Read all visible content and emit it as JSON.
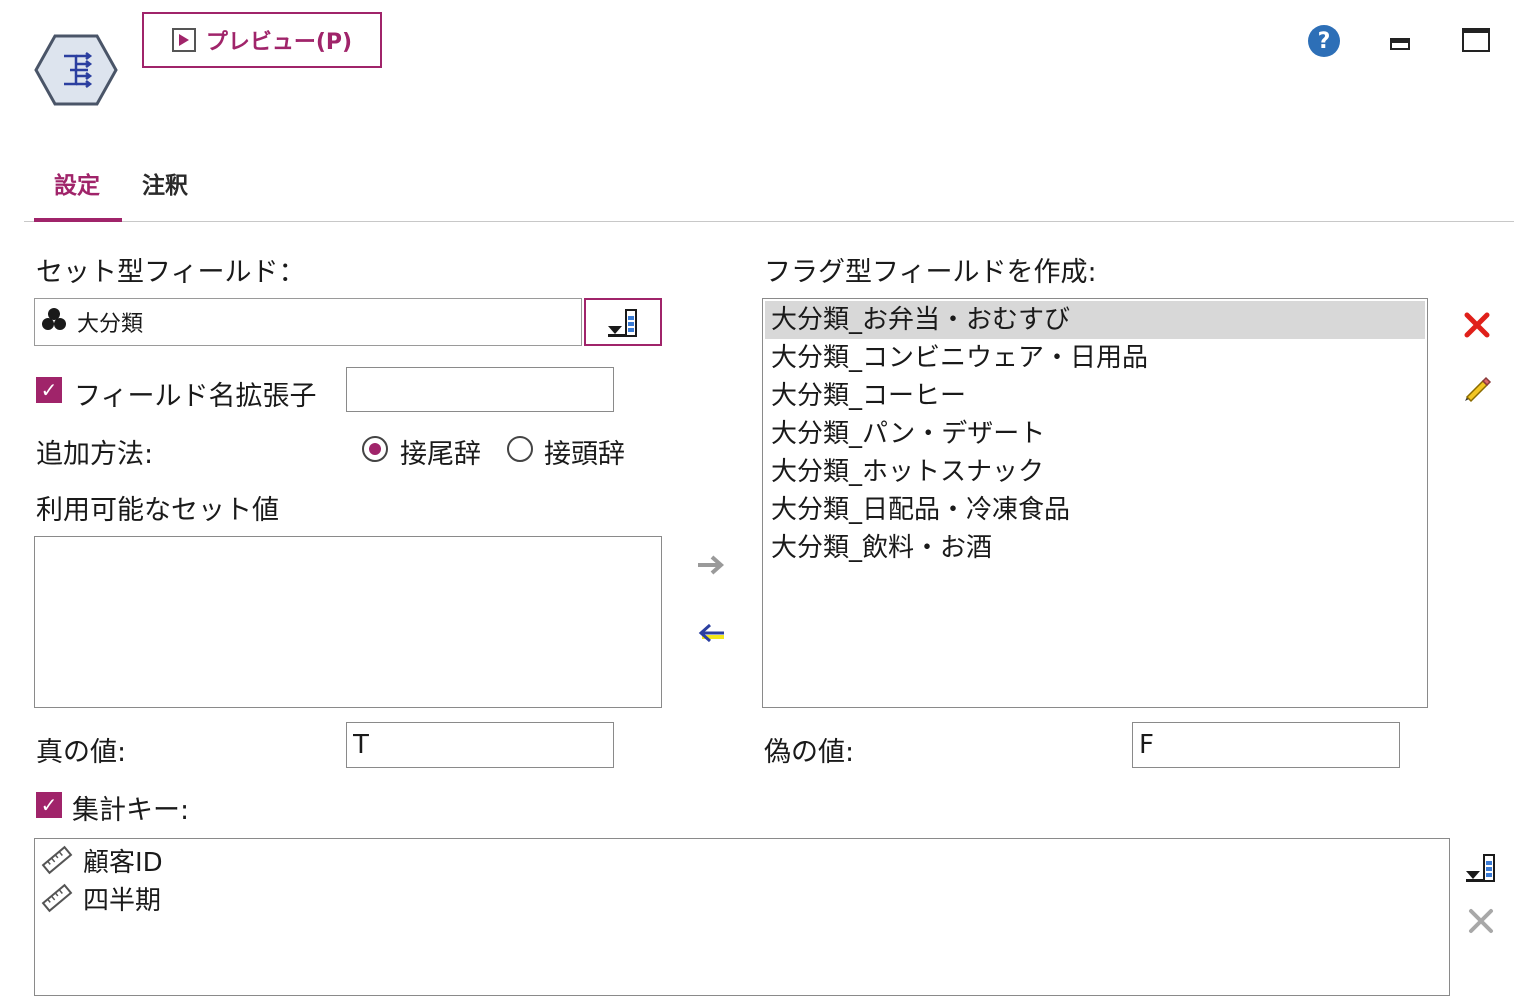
{
  "toolbar": {
    "preview_label": "プレビュー(P)"
  },
  "tabs": [
    {
      "label": "設定"
    },
    {
      "label": "注釈"
    }
  ],
  "settings": {
    "set_field_label": "セット型フィールド：",
    "set_field_value": "大分類",
    "suffix_checkbox_label": "フィールド名拡張子",
    "suffix_checked": true,
    "suffix_value": "",
    "add_method_label": "追加方法:",
    "add_method_options": [
      "接尾辞",
      "接頭辞"
    ],
    "add_method_selected": "接尾辞",
    "available_label": "利用可能なセット値",
    "available_values": [],
    "create_flags_label": "フラグ型フィールドを作成:",
    "flag_fields": [
      "大分類_お弁当・おむすび",
      "大分類_コンビニウェア・日用品",
      "大分類_コーヒー",
      "大分類_パン・デザート",
      "大分類_ホットスナック",
      "大分類_日配品・冷凍食品",
      "大分類_飲料・お酒"
    ],
    "selected_flag_index": 0,
    "true_label": "真の値:",
    "true_value": "T",
    "false_label": "偽の値:",
    "false_value": "F",
    "aggregate_label": "集計キー:",
    "aggregate_checked": true,
    "aggregate_keys": [
      "顧客ID",
      "四半期"
    ]
  },
  "colors": {
    "accent": "#a0246a",
    "help": "#2d6fb7",
    "delete": "#e0201a",
    "selection": "#d8d8d8"
  }
}
